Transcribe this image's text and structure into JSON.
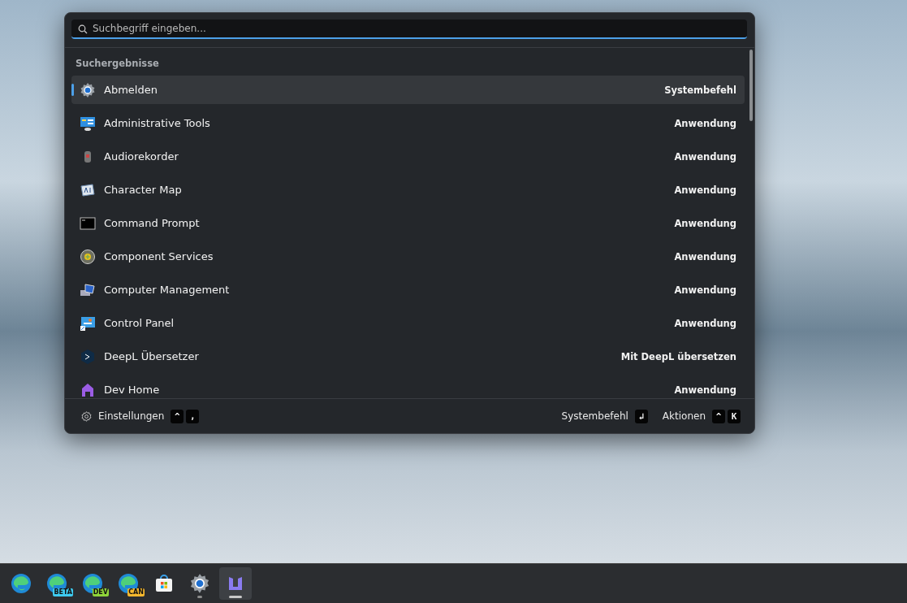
{
  "launcher": {
    "search": {
      "placeholder": "Suchbegriff eingeben..."
    },
    "section_title": "Suchergebnisse",
    "results": [
      {
        "kind": "gear",
        "title": "Abmelden",
        "type": "Systembefehl",
        "selected": true
      },
      {
        "kind": "admin",
        "title": "Administrative Tools",
        "type": "Anwendung",
        "selected": false
      },
      {
        "kind": "recorder",
        "title": "Audiorekorder",
        "type": "Anwendung",
        "selected": false
      },
      {
        "kind": "charmap",
        "title": "Character Map",
        "type": "Anwendung",
        "selected": false
      },
      {
        "kind": "terminal",
        "title": "Command Prompt",
        "type": "Anwendung",
        "selected": false
      },
      {
        "kind": "component",
        "title": "Component Services",
        "type": "Anwendung",
        "selected": false
      },
      {
        "kind": "computer",
        "title": "Computer Management",
        "type": "Anwendung",
        "selected": false
      },
      {
        "kind": "panel",
        "title": "Control Panel",
        "type": "Anwendung",
        "selected": false
      },
      {
        "kind": "deepl",
        "title": "DeepL Übersetzer",
        "type": "Mit DeepL übersetzen",
        "selected": false
      },
      {
        "kind": "devhome",
        "title": "Dev Home",
        "type": "Anwendung",
        "selected": false
      }
    ],
    "footer": {
      "settings": {
        "label": "Einstellungen",
        "keys": [
          "^",
          ","
        ]
      },
      "actions": [
        {
          "label": "Systembefehl",
          "keys": [
            "↲"
          ]
        },
        {
          "label": "Aktionen",
          "keys": [
            "^",
            "K"
          ]
        }
      ]
    }
  },
  "taskbar": [
    {
      "kind": "edge",
      "running": false,
      "active": false
    },
    {
      "kind": "edge",
      "badge": "BETA",
      "color": "#3ecbf0",
      "running": false,
      "active": false
    },
    {
      "kind": "edge",
      "badge": "DEV",
      "color": "#8fd43a",
      "running": false,
      "active": false
    },
    {
      "kind": "edge",
      "badge": "CAN",
      "color": "#f5b82e",
      "running": false,
      "active": false
    },
    {
      "kind": "store",
      "running": false,
      "active": false
    },
    {
      "kind": "settings",
      "running": true,
      "active": false
    },
    {
      "kind": "launcher",
      "running": true,
      "active": true
    }
  ]
}
